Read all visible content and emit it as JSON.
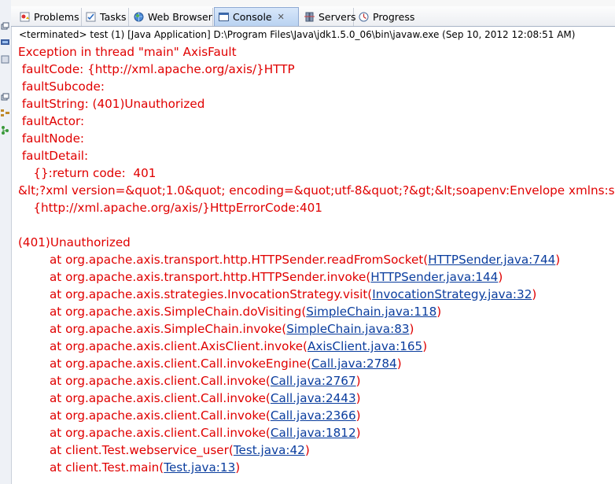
{
  "tabs": [
    {
      "label": "Problems",
      "icon": "problems-icon",
      "active": false
    },
    {
      "label": "Tasks",
      "icon": "tasks-icon",
      "active": false
    },
    {
      "label": "Web Browser",
      "icon": "globe-icon",
      "active": false
    },
    {
      "label": "Console",
      "icon": "console-icon",
      "active": true,
      "close": "✕"
    },
    {
      "label": "Servers",
      "icon": "servers-icon",
      "active": false
    },
    {
      "label": "Progress",
      "icon": "progress-icon",
      "active": false
    }
  ],
  "status_line": "<terminated> test (1) [Java Application] D:\\Program Files\\Java\\jdk1.5.0_06\\bin\\javaw.exe (Sep 10, 2012 12:08:51 AM)",
  "colors": {
    "error_text": "#e00000",
    "link_text": "#0a3d9e",
    "active_tab": "#c9ddf6"
  },
  "console": {
    "header_lines": [
      "Exception in thread \"main\" AxisFault",
      " faultCode: {http://xml.apache.org/axis/}HTTP",
      " faultSubcode: ",
      " faultString: (401)Unauthorized",
      " faultActor: ",
      " faultNode: ",
      " faultDetail: ",
      "\t{}:return code:  401",
      "&lt;?xml version=&quot;1.0&quot; encoding=&quot;utf-8&quot;?&gt;&lt;soapenv:Envelope xmlns:s",
      "\t{http://xml.apache.org/axis/}HttpErrorCode:401",
      "",
      "(401)Unauthorized"
    ],
    "stack": [
      {
        "text": "at org.apache.axis.transport.http.HTTPSender.readFromSocket(",
        "link": "HTTPSender.java:744",
        "end": ")"
      },
      {
        "text": "at org.apache.axis.transport.http.HTTPSender.invoke(",
        "link": "HTTPSender.java:144",
        "end": ")"
      },
      {
        "text": "at org.apache.axis.strategies.InvocationStrategy.visit(",
        "link": "InvocationStrategy.java:32",
        "end": ")"
      },
      {
        "text": "at org.apache.axis.SimpleChain.doVisiting(",
        "link": "SimpleChain.java:118",
        "end": ")"
      },
      {
        "text": "at org.apache.axis.SimpleChain.invoke(",
        "link": "SimpleChain.java:83",
        "end": ")"
      },
      {
        "text": "at org.apache.axis.client.AxisClient.invoke(",
        "link": "AxisClient.java:165",
        "end": ")"
      },
      {
        "text": "at org.apache.axis.client.Call.invokeEngine(",
        "link": "Call.java:2784",
        "end": ")"
      },
      {
        "text": "at org.apache.axis.client.Call.invoke(",
        "link": "Call.java:2767",
        "end": ")"
      },
      {
        "text": "at org.apache.axis.client.Call.invoke(",
        "link": "Call.java:2443",
        "end": ")"
      },
      {
        "text": "at org.apache.axis.client.Call.invoke(",
        "link": "Call.java:2366",
        "end": ")"
      },
      {
        "text": "at org.apache.axis.client.Call.invoke(",
        "link": "Call.java:1812",
        "end": ")"
      },
      {
        "text": "at client.Test.webservice_user(",
        "link": "Test.java:42",
        "end": ")"
      },
      {
        "text": "at client.Test.main(",
        "link": "Test.java:13",
        "end": ")"
      }
    ]
  }
}
